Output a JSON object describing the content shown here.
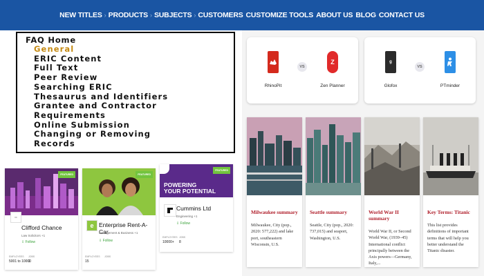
{
  "nav": {
    "items": [
      {
        "label": "NEW TITLES",
        "sep": ""
      },
      {
        "label": "PRODUCTS",
        "sep": "›"
      },
      {
        "label": "SUBJECTS",
        "sep": "›"
      },
      {
        "label": "CUSTOMERS",
        "sep": "›"
      },
      {
        "label": "CUSTOMIZE TOOLS",
        "sep": ""
      },
      {
        "label": "ABOUT US",
        "sep": ""
      },
      {
        "label": "BLOG",
        "sep": ""
      },
      {
        "label": "CONTACT US",
        "sep": ""
      }
    ],
    "bg_color": "#1a55a3"
  },
  "faq": {
    "home": "FAQ Home",
    "entries": [
      "General",
      "ERIC Content",
      "Full Text",
      "Peer Review",
      "Searching ERIC",
      "Thesaurus and Identifiers",
      "Grantee and Contractor",
      "Requirements",
      "Online Submission",
      "Changing or Removing",
      "Records"
    ],
    "active_color": "#c58a12"
  },
  "comparisons": [
    {
      "left": {
        "name": "RhinoPit",
        "logo_text": "R",
        "color": "#d42a1d"
      },
      "vs": "VS",
      "right": {
        "name": "Zen Planner",
        "logo_text": "Z",
        "color": "#e12a2a"
      }
    },
    {
      "left": {
        "name": "Glofox",
        "logo_text": "g",
        "color": "#2b2b2b"
      },
      "vs": "VS",
      "right": {
        "name": "PTminder",
        "logo_text": "P",
        "color": "#2d8fe6"
      }
    }
  ],
  "summaries": [
    {
      "title": "Milwaukee summary",
      "desc": "Milwaukee, City (pop., 2020: 577,222) and lake port, southeastern Wisconsin, U.S."
    },
    {
      "title": "Seattle summary",
      "desc": "Seattle, City (pop., 2020: 737,015) and seaport, Washington, U.S."
    },
    {
      "title": "World War II summary",
      "desc": "World War II, or Second World War, (1939–45) International conflict principally between the Axis powers—Germany, Italy,..."
    },
    {
      "title": "Key Terms: Titanic",
      "desc": "This list provides definitions of important terms that will help you better understand the Titanic disaster."
    }
  ],
  "companies": [
    {
      "name": "Clifford Chance",
      "industry": "Law Solicitors +1",
      "follow": "Follow",
      "featured": "FEATURED",
      "stat1_label": "EMPLOYEES",
      "stat1_value": "5001 to 10000",
      "stat2_label": "JOBS",
      "stat2_value": "1"
    },
    {
      "name": "Enterprise Rent-A-Car",
      "industry": "Management & Business +1",
      "follow": "Follow",
      "featured": "FEATURED",
      "stat1_label": "EMPLOYEES",
      "stat1_value": "",
      "stat2_label": "JOBS",
      "stat2_value": "15"
    },
    {
      "name": "Cummins Ltd",
      "industry": "Engineering +1",
      "follow": "Follow",
      "featured": "FEATURED",
      "banner_line1": "POWERING",
      "banner_line2": "YOUR POTENTIAL",
      "stat1_label": "EMPLOYEES",
      "stat1_value": "10000+",
      "stat2_label": "JOBS",
      "stat2_value": "8"
    }
  ]
}
